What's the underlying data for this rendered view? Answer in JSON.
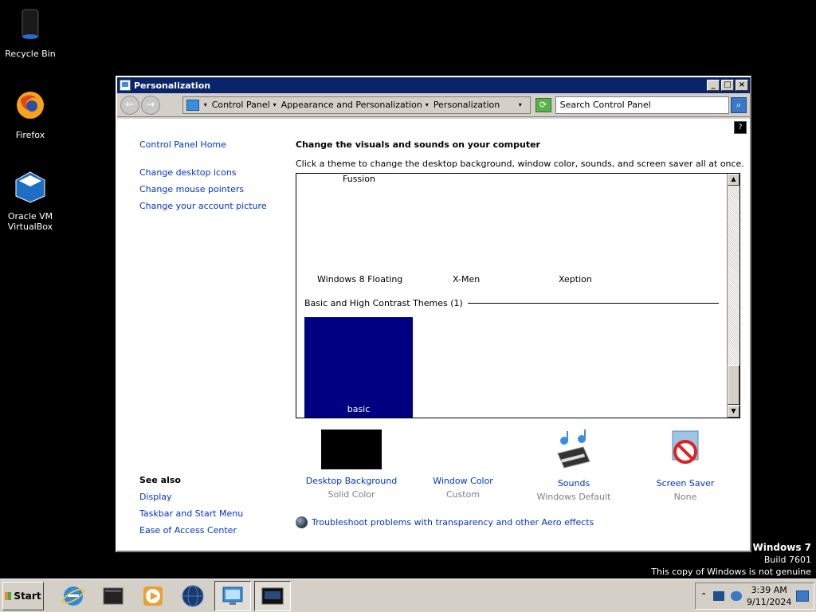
{
  "desktop": {
    "icons": [
      {
        "label": "Recycle Bin",
        "icon": "recycle-bin-icon"
      },
      {
        "label": "Firefox",
        "icon": "firefox-icon"
      },
      {
        "label": "Oracle VM VirtualBox",
        "icon": "virtualbox-icon"
      }
    ],
    "watermark": {
      "title": "Windows 7",
      "build": "Build 7601",
      "notice": "This copy of Windows is not genuine"
    }
  },
  "window": {
    "title": "Personalization",
    "controls": {
      "minimize": "_",
      "maximize": "□",
      "close": "×"
    },
    "address": {
      "crumbs": [
        "Control Panel",
        "Appearance and Personalization",
        "Personalization"
      ],
      "separator": "▾"
    },
    "search": {
      "placeholder": "Search Control Panel"
    }
  },
  "sidebar": {
    "home_link": "Control Panel Home",
    "links": [
      "Change desktop icons",
      "Change mouse pointers",
      "Change your account picture"
    ],
    "see_also": {
      "heading": "See also",
      "links": [
        "Display",
        "Taskbar and Start Menu",
        "Ease of Access Center"
      ]
    }
  },
  "main": {
    "title": "Change the visuals and sounds on your computer",
    "subtitle": "Click a theme to change the desktop background, window color, sounds, and screen saver all at once.",
    "themes": [
      "Fussion",
      "Windows 8 Floating",
      "X-Men",
      "Xeption"
    ],
    "basic_group": "Basic and High Contrast Themes (1)",
    "basic_theme": "basic",
    "bottom_items": [
      {
        "label": "Desktop Background",
        "sub": "Solid Color",
        "icon": "desktop-background-swatch"
      },
      {
        "label": "Window Color",
        "sub": "Custom",
        "icon": "window-color-swatch"
      },
      {
        "label": "Sounds",
        "sub": "Windows Default",
        "icon": "sounds-icon"
      },
      {
        "label": "Screen Saver",
        "sub": "None",
        "icon": "screen-saver-icon"
      }
    ],
    "troubleshoot": "Troubleshoot problems with transparency and other Aero effects"
  },
  "taskbar": {
    "start_label": "Start",
    "buttons": [
      "internet-explorer-icon",
      "file-explorer-icon",
      "media-player-icon",
      "network-globe-icon",
      "control-panel-icon",
      "screen-capture-icon"
    ],
    "clock": {
      "time": "3:39 AM",
      "date": "9/11/2024"
    }
  },
  "colors": {
    "title_bar": "#0a246a",
    "link": "#0033cc",
    "basic_theme_tile": "#000080",
    "desktop": "#000000"
  }
}
